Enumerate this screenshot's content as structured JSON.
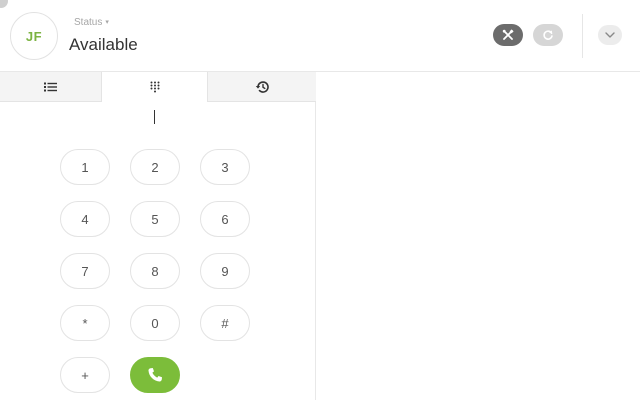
{
  "header": {
    "avatar_initials": "JF",
    "status_caption": "Status",
    "status_caret": "▾",
    "status_value": "Available"
  },
  "icons": {
    "tools": "tools-icon",
    "refresh": "refresh-icon",
    "expand": "chevron-down-icon",
    "contacts": "list-icon",
    "keypad": "keypad-icon",
    "history": "history-icon",
    "call": "phone-icon"
  },
  "keypad": {
    "rows": [
      [
        "1",
        "2",
        "3"
      ],
      [
        "4",
        "5",
        "6"
      ],
      [
        "7",
        "8",
        "9"
      ],
      [
        "*",
        "0",
        "#"
      ],
      [
        "+"
      ]
    ]
  },
  "colors": {
    "accent": "#7cbd3a",
    "tools_button": "#6c6c6c",
    "refresh_button": "#d6d6d6"
  }
}
